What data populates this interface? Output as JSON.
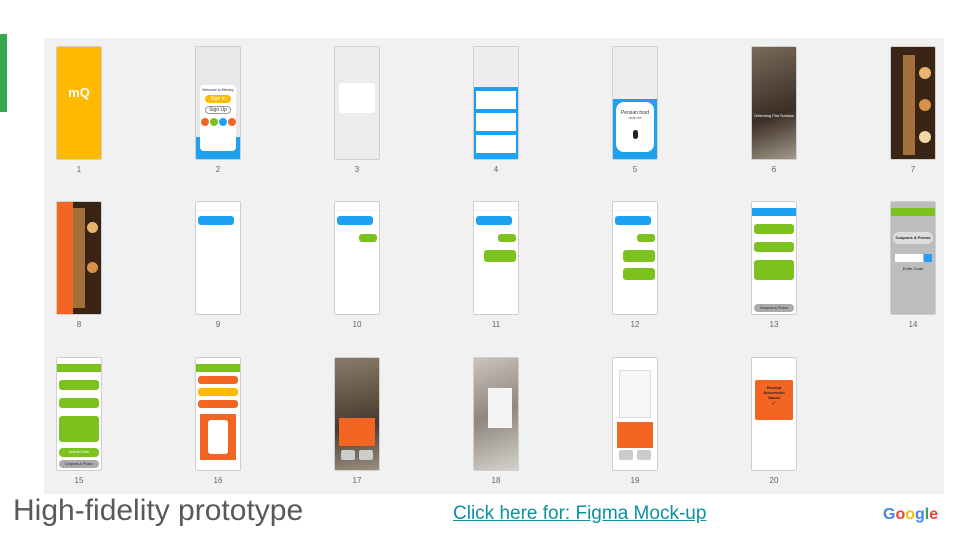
{
  "slide": {
    "title": "High-fidelity prototype",
    "link": "Click here for: Figma Mock-up",
    "logo": "Google",
    "colors": {
      "accent": "#34a853",
      "link": "#0f8f9f",
      "brand_yellow": "#ffb900",
      "chat_blue": "#1da1f2",
      "chat_green": "#7cc21e",
      "alert_orange": "#f26522"
    }
  },
  "screens": [
    {
      "num": "1",
      "logo": "mQ"
    },
    {
      "num": "2",
      "welcome": "Welcome to Mimasy",
      "sign_in": "Sign In",
      "sign_up": "Sign Up"
    },
    {
      "num": "3"
    },
    {
      "num": "4"
    },
    {
      "num": "5",
      "voice_text": "Persian food",
      "voice_sub": "near me"
    },
    {
      "num": "6",
      "scan_text": "Detecting Flat Surface"
    },
    {
      "num": "7"
    },
    {
      "num": "8"
    },
    {
      "num": "9"
    },
    {
      "num": "10"
    },
    {
      "num": "11"
    },
    {
      "num": "12"
    },
    {
      "num": "13",
      "bottom": "Coupons & Promo"
    },
    {
      "num": "14",
      "coupons": "Coupons & Promo",
      "enter_code": "Enter Code"
    },
    {
      "num": "15",
      "submit": "Submit Order",
      "bottom": "Coupons & Promo"
    },
    {
      "num": "16"
    },
    {
      "num": "17"
    },
    {
      "num": "18"
    },
    {
      "num": "19"
    },
    {
      "num": "20",
      "receipt": "Receipt Successful Saved"
    }
  ]
}
